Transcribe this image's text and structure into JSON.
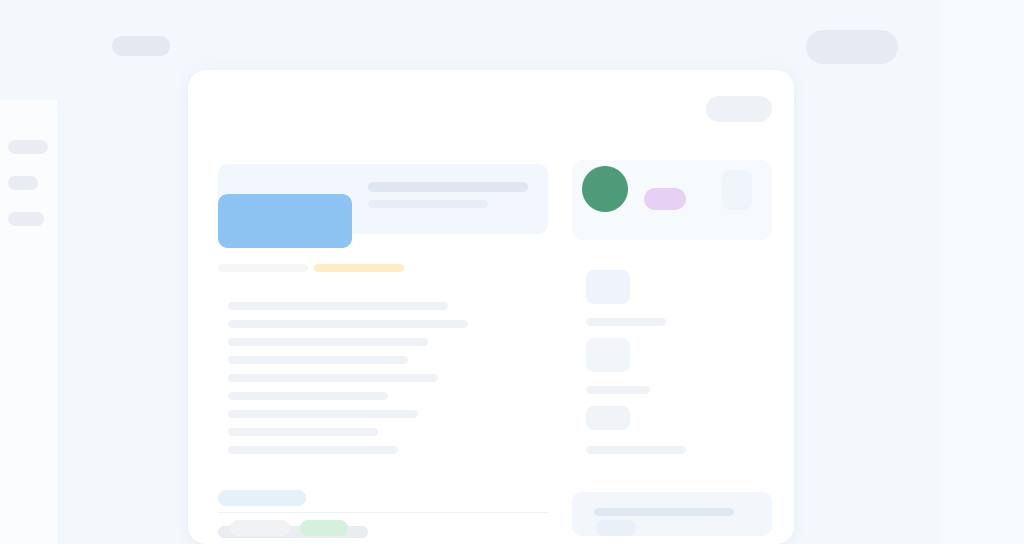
{
  "topbar": {
    "signin_label": ""
  },
  "card": {
    "title": "",
    "subtitle": "",
    "action_label": ""
  },
  "primary_button": {
    "label": ""
  },
  "colors": {
    "page_bg": "#f3f8fd",
    "card_bg": "#ffffff",
    "primary": "#8cc3f2",
    "avatar": "#4f9a78",
    "accent_purple": "#e6d1f5",
    "tag_yellow": "#fbeec7",
    "tag_green": "#d5f0dd"
  },
  "icons": {
    "avatar": "user-avatar-icon"
  }
}
